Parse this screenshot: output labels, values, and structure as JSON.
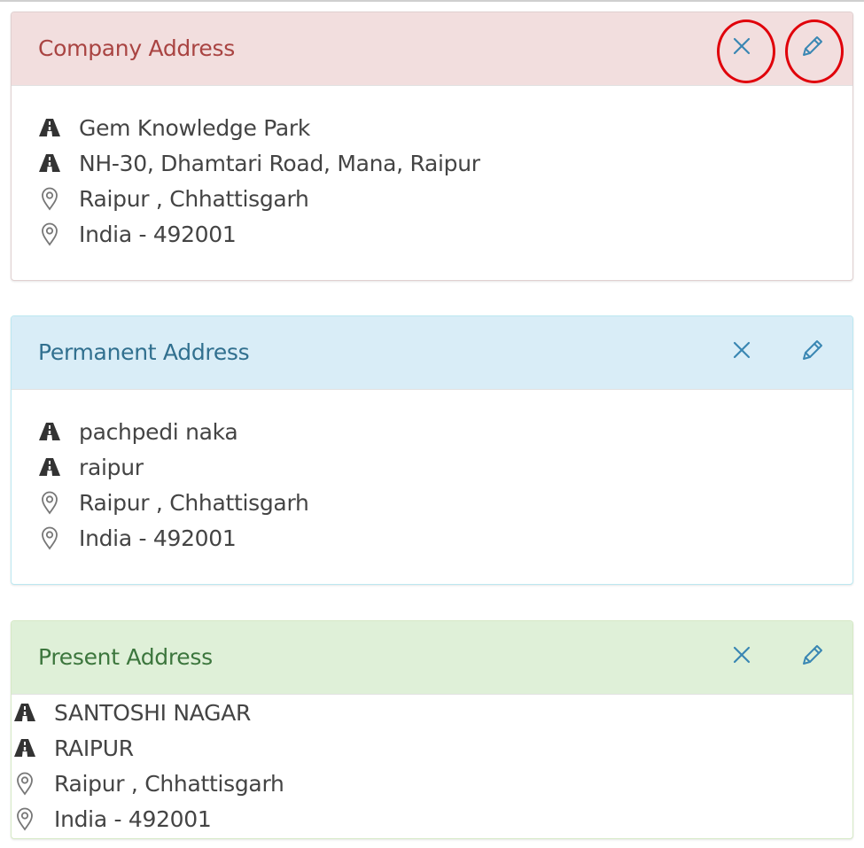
{
  "panels": [
    {
      "id": "company",
      "title": "Company Address",
      "colors": {
        "header_bg": "#f2dede",
        "title": "#a94442",
        "icon": "#3a87b3",
        "border": "#e0d0d0"
      },
      "highlighted": true,
      "lines": [
        {
          "icon": "road-icon",
          "text": "Gem Knowledge Park"
        },
        {
          "icon": "road-icon",
          "text": "NH-30, Dhamtari Road, Mana, Raipur"
        },
        {
          "icon": "map-marker-icon",
          "text": "Raipur , Chhattisgarh"
        },
        {
          "icon": "map-marker-icon",
          "text": "India - 492001"
        }
      ]
    },
    {
      "id": "permanent",
      "title": "Permanent Address",
      "colors": {
        "header_bg": "#d9edf7",
        "title": "#31708f",
        "icon": "#3a87b3",
        "border": "#bce8f1"
      },
      "highlighted": false,
      "lines": [
        {
          "icon": "road-icon",
          "text": "pachpedi naka"
        },
        {
          "icon": "road-icon",
          "text": "raipur"
        },
        {
          "icon": "map-marker-icon",
          "text": "Raipur , Chhattisgarh"
        },
        {
          "icon": "map-marker-icon",
          "text": "India - 492001"
        }
      ]
    },
    {
      "id": "present",
      "title": "Present Address",
      "colors": {
        "header_bg": "#dff0d8",
        "title": "#3c763d",
        "icon": "#3a87b3",
        "border": "#d6e9c6"
      },
      "highlighted": false,
      "lines": [
        {
          "icon": "road-icon",
          "text": "SANTOSHI NAGAR"
        },
        {
          "icon": "road-icon",
          "text": "RAIPUR"
        },
        {
          "icon": "map-marker-icon",
          "text": "Raipur , Chhattisgarh"
        },
        {
          "icon": "map-marker-icon",
          "text": "India - 492001"
        }
      ]
    }
  ]
}
